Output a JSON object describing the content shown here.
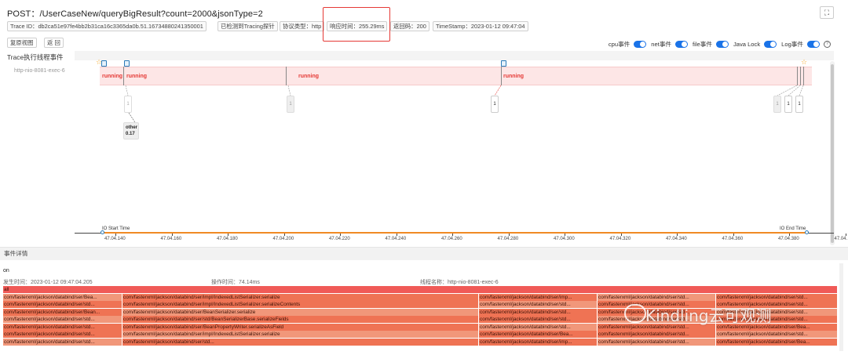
{
  "header": {
    "title": "POST：/UserCaseNew/queryBigResult?count=2000&jsonType=2"
  },
  "tags": {
    "trace_id": "Trace ID：db2ca51e97fe4bb2b31ca16c3365da0b.51.16734880241350001",
    "tracing_detected": "已检测到Tracing探针",
    "protocol": "协议类型：http",
    "response_time": "响应时间：255.29ms",
    "return_code": "返回码：200",
    "timestamp": "TimeStamp：2023-01-12 09:47:04"
  },
  "buttons": {
    "restore_view": "复原视图",
    "back": "返 回"
  },
  "toggles": [
    {
      "label": "cpu事件",
      "on": true
    },
    {
      "label": "net事件",
      "on": true
    },
    {
      "label": "file事件",
      "on": true
    },
    {
      "label": "Java Lock",
      "on": true
    },
    {
      "label": "Log事件",
      "on": true
    }
  ],
  "trace": {
    "section_title": "Trace执行线程事件",
    "thread_name": "http-nio-8081-exec-6",
    "run_labels": [
      "running",
      "running",
      "running",
      "running"
    ],
    "counts": [
      "1",
      "1",
      "1",
      "1",
      "1",
      "1"
    ],
    "other_label": "other",
    "other_value": "0.17"
  },
  "axis": {
    "io_start": "IO Start Time",
    "io_end": "IO End Time",
    "ticks": [
      "47.04.140",
      "47.04.160",
      "47.04.180",
      "47.04.200",
      "47.04.220",
      "47.04.240",
      "47.04.260",
      "47.04.280",
      "47.04.300",
      "47.04.320",
      "47.04.340",
      "47.04.360",
      "47.04.380",
      "47.04."
    ]
  },
  "details": {
    "header": "事件详情",
    "on_label": "on",
    "occur_time": "发生时间：2023-01-12 09:47:04.205",
    "op_time": "操作时间：74.14ms",
    "thread": "线程名称：http-nio-8081-exec-6"
  },
  "flame": {
    "root": "all",
    "rows": [
      [
        "com/fasterxml/jackson/databind/ser/Bea...",
        "com/fasterxml/jackson/databind/ser/impl/IndexedListSerializer.serialize",
        "com/fasterxml/jackson/databind/ser/imp...",
        "com/fasterxml/jackson/databind/ser/std...",
        "com/fasterxml/jackson/databind/ser/std..."
      ],
      [
        "com/fasterxml/jackson/databind/ser/std...",
        "com/fasterxml/jackson/databind/ser/impl/IndexedListSerializer.serializeContents",
        "com/fasterxml/jackson/databind/ser/std...",
        "com/fasterxml/jackson/databind/ser/std...",
        "com/fasterxml/jackson/databind/ser/std..."
      ],
      [
        "com/fasterxml/jackson/databind/ser/Bean...",
        "com/fasterxml/jackson/databind/ser/BeanSerializer.serialize",
        "com/fasterxml/jackson/databind/ser/std...",
        "com/fasterxml/jackson/databind/ser/std...",
        "com/fasterxml/jackson/databind/ser/std..."
      ],
      [
        "com/fasterxml/jackson/databind/ser/std...",
        "com/fasterxml/jackson/databind/ser/std/BeanSerializerBase.serializeFields",
        "com/fasterxml/jackson/databind/ser/std...",
        "com/fasterxml/jackson/databind/ser/std...",
        "com/fasterxml/jackson/databind/ser/std..."
      ],
      [
        "com/fasterxml/jackson/databind/ser/std...",
        "com/fasterxml/jackson/databind/ser/BeanPropertyWriter.serializeAsField",
        "com/fasterxml/jackson/databind/ser/std...",
        "com/fasterxml/jackson/databind/ser/std...",
        "com/fasterxml/jackson/databind/ser/Bea..."
      ],
      [
        "com/fasterxml/jackson/databind/ser/std...",
        "com/fasterxml/jackson/databind/ser/impl/IndexedListSerializer.serialize",
        "com/fasterxml/jackson/databind/ser/Bea...",
        "com/fasterxml/jackson/databind/ser/std...",
        "com/fasterxml/jackson/databind/ser/std..."
      ],
      [
        "com/fasterxml/jackson/databind/ser/std...",
        "com/fasterxml/jackson/databind/ser/std...",
        "com/fasterxml/jackson/databind/ser/imp...",
        "com/fasterxml/jackson/databind/ser/std...",
        "com/fasterxml/jackson/databind/ser/Bea..."
      ]
    ]
  },
  "watermark": "Kindling云可观测",
  "colors": {
    "accent": "#1a73e8",
    "running_bg": "#fde6e6",
    "running_text": "#e53935",
    "flame": "#ef7354",
    "io_line": "#f08a24"
  }
}
